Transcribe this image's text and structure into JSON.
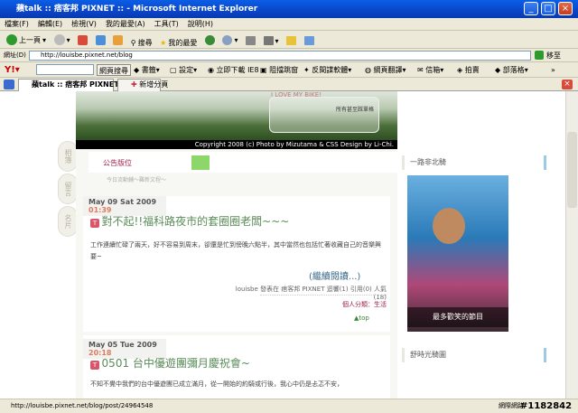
{
  "window": {
    "title": "蘋talk :: 痞客邦 PIXNET :: - Microsoft Internet Explorer"
  },
  "menu": [
    "檔案(F)",
    "編輯(E)",
    "檢視(V)",
    "我的最愛(A)",
    "工具(T)",
    "說明(H)"
  ],
  "toolbar": {
    "back": "上一頁",
    "search": "搜尋",
    "favorites": "我的最愛"
  },
  "address": {
    "label": "網址(D)",
    "url": "http://louisbe.pixnet.net/blog",
    "go": "移至"
  },
  "yahoo": {
    "search_btn": "網頁搜尋",
    "items": [
      "書籤",
      "設定",
      "立即下載 IE8",
      "阻擋跳窗",
      "反間諜軟體",
      "網頁翻譯",
      "信箱",
      "拍賣",
      "部落格"
    ]
  },
  "tabs": {
    "active": "蘋talk :: 痞客邦 PIXNET ::",
    "new": "新增分頁"
  },
  "side_buttons": [
    "相簿",
    "留言",
    "名片"
  ],
  "banner": {
    "slogan": "I LOVE MY BIKE!",
    "sub": "所有甚至踩單格",
    "copyright": "Copyright 2008 (c) Photo by Mizutama & CSS Design by Li-Chi."
  },
  "notice": {
    "title": "公告版位",
    "marquee": "今日流動輔〜難新文程〜"
  },
  "posts": [
    {
      "date": "May 09 Sat 2009",
      "time": "01:39",
      "title": "對不起!!福科路夜市的套圈圈老闆~~~",
      "body": "工作連續忙碌了兩天，好不容易到周末，卻還是忙到傍晚六點半，其中當然也包括忙著收藏自己的音樂興要~",
      "more": "(繼續閱讀...)",
      "meta": "louisbe 發表在 痞客邦 PIXNET 迴響(1) 引用(0) 人氣(18)",
      "category": "個人分類：生活",
      "top": "top"
    },
    {
      "date": "May 05 Tue 2009",
      "time": "20:18",
      "title": "0501 台中優遊團彌月慶祝會~",
      "body": "不知不覺中我們的台中優遊團已成立滿月，從一開始的約騎或行後，我心中仍是忐忑不安，",
      "more": "",
      "meta": "",
      "category": "",
      "top": ""
    }
  ],
  "sidebar": {
    "section1": "一路非北騎",
    "photo_caption": "最多歡笑的節目",
    "section2": "舒時光騎圖"
  },
  "status": {
    "url": "http://louisbe.pixnet.net/blog/post/24964548",
    "zone": "網際網路",
    "watermark": "#1182842"
  }
}
